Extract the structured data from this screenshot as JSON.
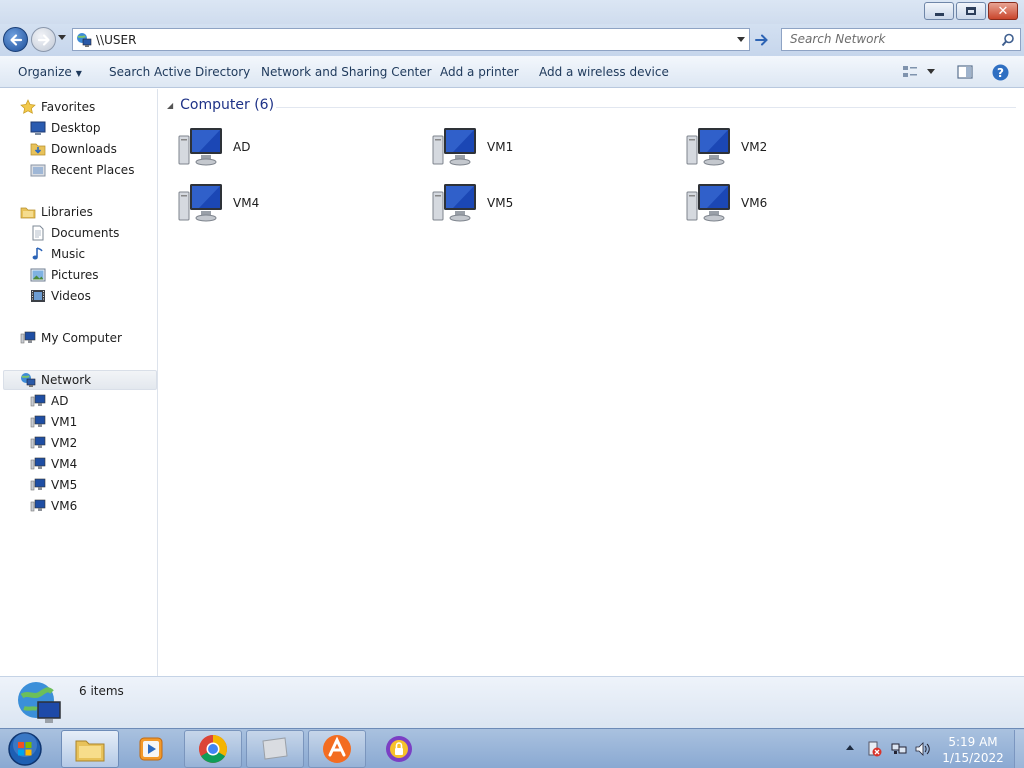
{
  "window": {
    "controls": {
      "minimize_icon": "minimize-icon",
      "maximize_icon": "restore-icon",
      "close_icon": "close-icon"
    }
  },
  "address": {
    "path": "\\\\USER",
    "search_placeholder": "Search Network"
  },
  "toolbar": {
    "organize": "Organize",
    "search_ad": "Search Active Directory",
    "network_sharing": "Network and Sharing Center",
    "add_printer": "Add a printer",
    "add_wireless": "Add a wireless device"
  },
  "nav": {
    "favorites": {
      "label": "Favorites",
      "items": [
        "Desktop",
        "Downloads",
        "Recent Places"
      ]
    },
    "libraries": {
      "label": "Libraries",
      "items": [
        "Documents",
        "Music",
        "Pictures",
        "Videos"
      ]
    },
    "my_computer": "My Computer",
    "network": {
      "label": "Network",
      "items": [
        "AD",
        "VM1",
        "VM2",
        "VM4",
        "VM5",
        "VM6"
      ]
    }
  },
  "main": {
    "group_header": "Computer (6)",
    "computers": [
      "AD",
      "VM1",
      "VM2",
      "VM4",
      "VM5",
      "VM6"
    ]
  },
  "details": {
    "item_count": "6 items"
  },
  "taskbar": {
    "clock_time": "5:19 AM",
    "clock_date": "1/15/2022"
  },
  "colors": {
    "accent": "#1e3287",
    "taskbar": "#8aa9d2",
    "toolbar_text": "#1e395b"
  }
}
